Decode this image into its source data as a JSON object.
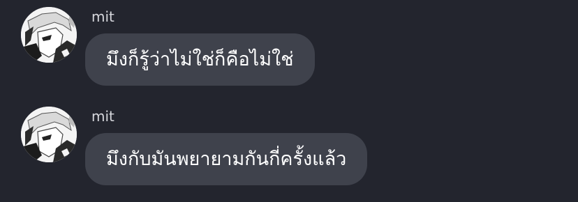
{
  "messages": [
    {
      "sender": "mit",
      "avatar_icon": "user-avatar-manga-portrait",
      "text": "มึงก็รู้ว่าไม่ใช่ก็คือไม่ใช่"
    },
    {
      "sender": "mit",
      "avatar_icon": "user-avatar-manga-portrait",
      "text": "มึงกับมันพยายามกันกี่ครั้งแล้ว"
    }
  ],
  "colors": {
    "background": "#23252e",
    "bubble": "#3f424c",
    "sender_text": "#d6d7dc",
    "message_text": "#ffffff"
  }
}
